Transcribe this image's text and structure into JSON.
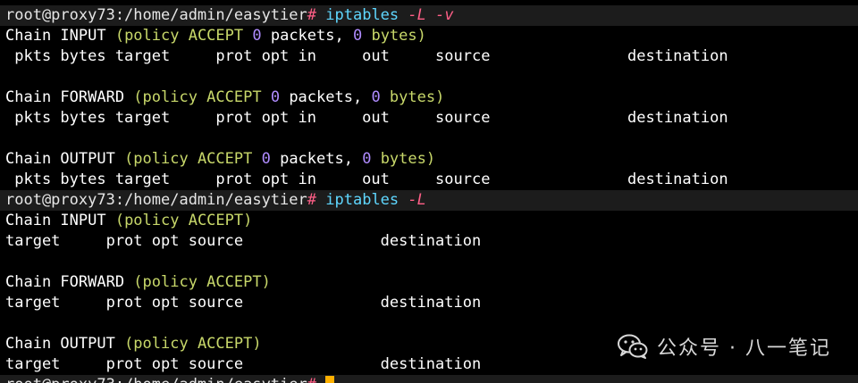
{
  "top_partial_line": "      ·····················································",
  "prompt": {
    "user_host_path": "root@proxy73:/home/admin/easytier",
    "hash": "#"
  },
  "cmd1": {
    "command": "iptables",
    "flags": "-L -v"
  },
  "cmd2": {
    "command": "iptables",
    "flags": "-L"
  },
  "verbose_output": {
    "chains": [
      {
        "prefix": "Chain INPUT ",
        "policy_open": "(policy ACCEPT ",
        "packets": "0",
        "mid": " packets, ",
        "bytes": "0",
        "close": " bytes)"
      },
      {
        "prefix": "Chain FORWARD ",
        "policy_open": "(policy ACCEPT ",
        "packets": "0",
        "mid": " packets, ",
        "bytes": "0",
        "close": " bytes)"
      },
      {
        "prefix": "Chain OUTPUT ",
        "policy_open": "(policy ACCEPT ",
        "packets": "0",
        "mid": " packets, ",
        "bytes": "0",
        "close": " bytes)"
      }
    ],
    "header": " pkts bytes target     prot opt in     out     source               destination"
  },
  "plain_output": {
    "chains": [
      {
        "prefix": "Chain INPUT ",
        "policy": "(policy ACCEPT)"
      },
      {
        "prefix": "Chain FORWARD ",
        "policy": "(policy ACCEPT)"
      },
      {
        "prefix": "Chain OUTPUT ",
        "policy": "(policy ACCEPT)"
      }
    ],
    "header": "target     prot opt source               destination"
  },
  "watermark": {
    "text": "公众号 · 八一笔记",
    "icon": "wechat-icon"
  },
  "colors": {
    "background": "#000000",
    "prompt_bar": "#1c1c1c",
    "hash": "#ff5f87",
    "command": "#5fd7ff",
    "paren": "#c8d86a",
    "number": "#b08cff",
    "cursor": "#ffb000"
  }
}
